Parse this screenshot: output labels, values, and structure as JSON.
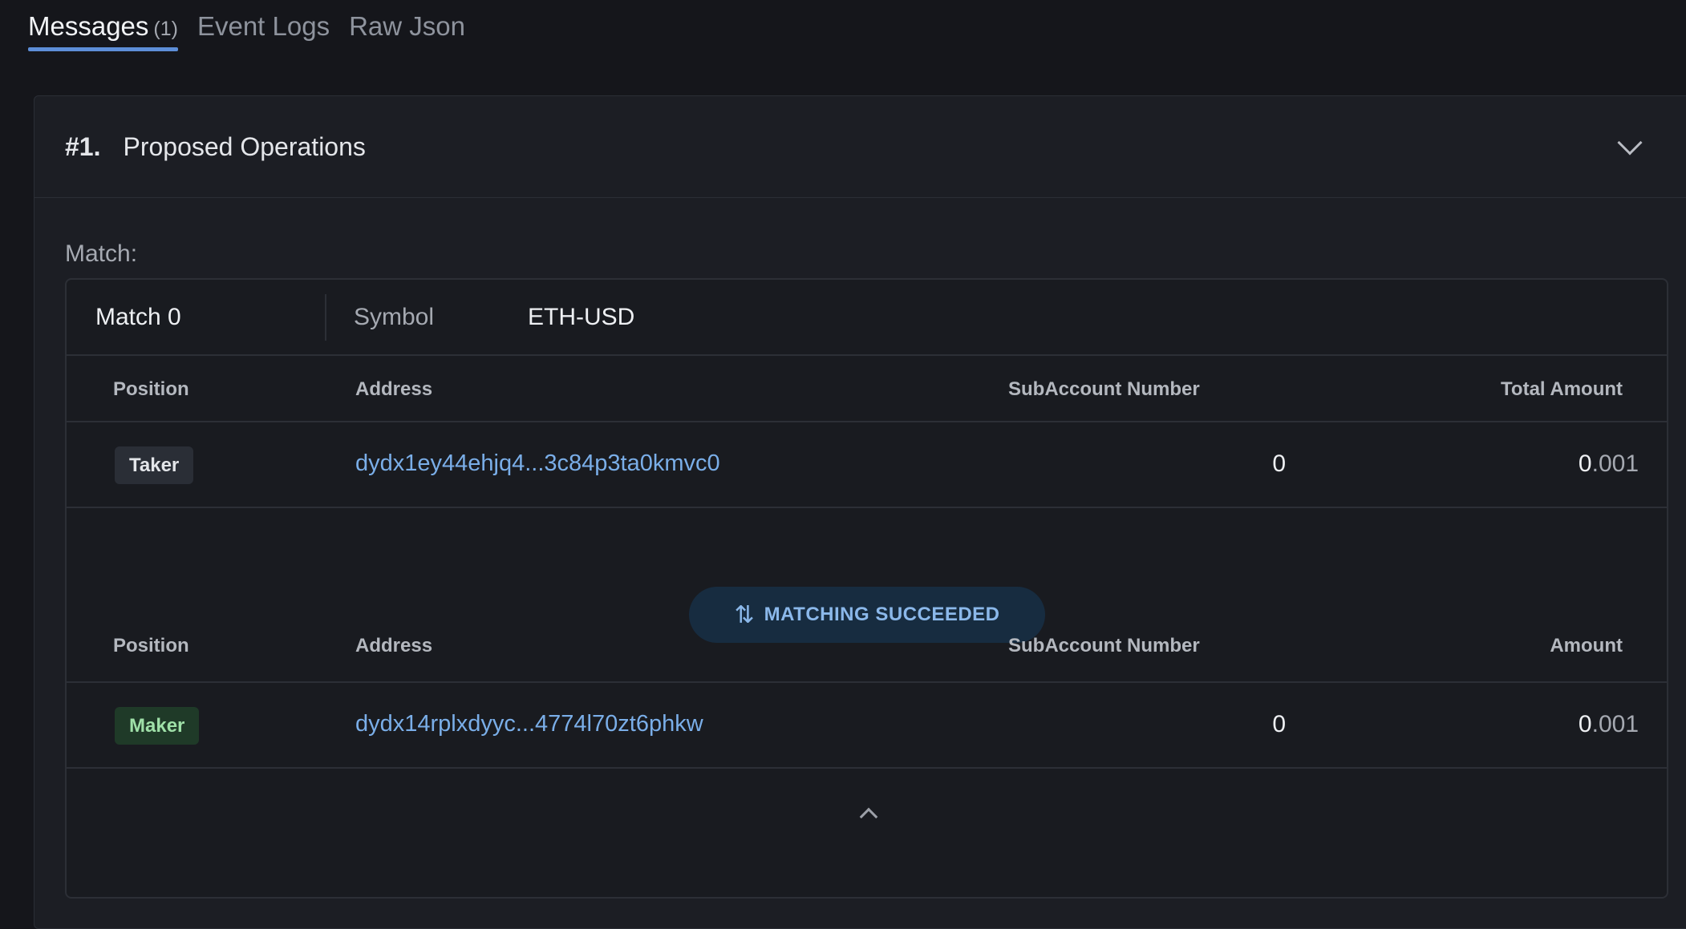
{
  "tabs": [
    {
      "label": "Messages",
      "count": "(1)"
    },
    {
      "label": "Event Logs"
    },
    {
      "label": "Raw Json"
    }
  ],
  "card": {
    "index": "#1.",
    "title": "Proposed Operations"
  },
  "match": {
    "section_label": "Match:",
    "name": "Match 0",
    "symbol_label": "Symbol",
    "symbol_value": "ETH-USD"
  },
  "taker_table": {
    "headers": {
      "position": "Position",
      "address": "Address",
      "subaccount": "SubAccount Number",
      "amount": "Total Amount"
    },
    "row": {
      "position": "Taker",
      "address": "dydx1ey44ehjq4...3c84p3ta0kmvc0",
      "subaccount": "0",
      "amount_int": "0",
      "amount_dec": ".001"
    }
  },
  "status": {
    "icon": "swap-vertical-arrows-icon",
    "label": "MATCHING SUCCEEDED"
  },
  "maker_table": {
    "headers": {
      "position": "Position",
      "address": "Address",
      "subaccount": "SubAccount Number",
      "amount": "Amount"
    },
    "row": {
      "position": "Maker",
      "address": "dydx14rplxdyyc...4774l70zt6phkw",
      "subaccount": "0",
      "amount_int": "0",
      "amount_dec": ".001"
    }
  },
  "colors": {
    "accent": "#5d8ed8",
    "link": "#7aaee8",
    "success_pill_bg": "#172c40",
    "maker_badge_bg": "#1f3a28",
    "maker_badge_text": "#9fe0a8"
  }
}
